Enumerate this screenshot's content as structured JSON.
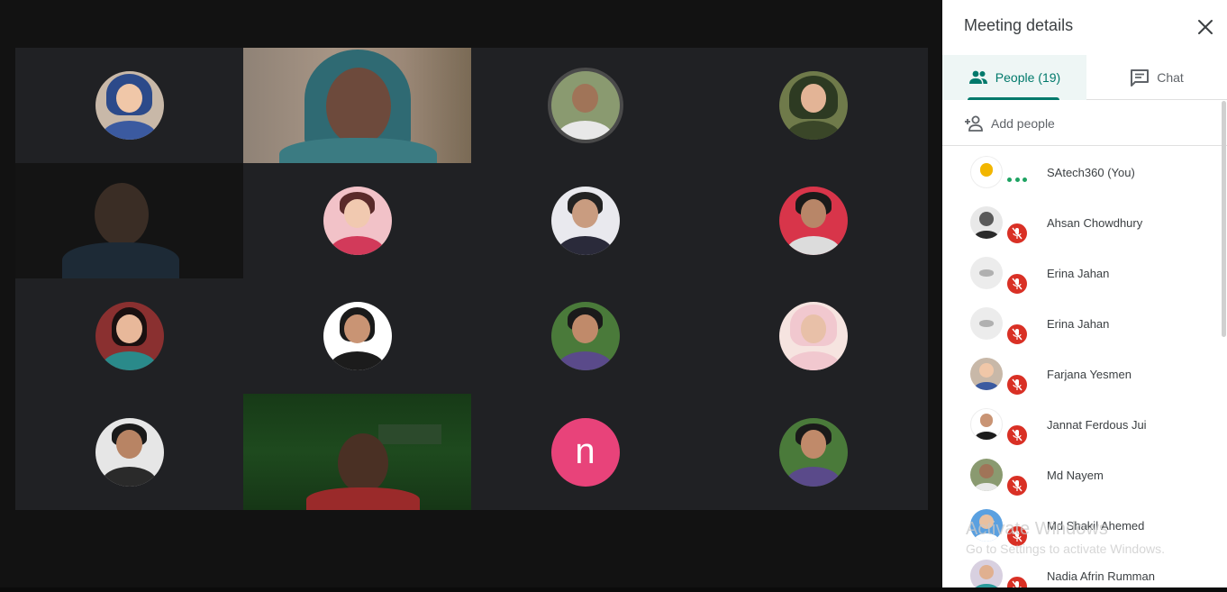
{
  "panel": {
    "title": "Meeting details",
    "tabs": [
      {
        "label": "People (19)",
        "icon": "people-icon",
        "active": true
      },
      {
        "label": "Chat",
        "icon": "chat-icon",
        "active": false
      }
    ],
    "add_people_label": "Add people",
    "participants": [
      {
        "name": "SAtech360 (You)",
        "status": "speaking-dots"
      },
      {
        "name": "Ahsan Chowdhury",
        "status": "muted"
      },
      {
        "name": "Erina Jahan",
        "status": "muted"
      },
      {
        "name": "Erina Jahan",
        "status": "muted"
      },
      {
        "name": "Farjana Yesmen",
        "status": "muted"
      },
      {
        "name": "Jannat Ferdous Jui",
        "status": "muted"
      },
      {
        "name": "Md Nayem",
        "status": "muted"
      },
      {
        "name": "Md Shakil Ahemed",
        "status": "muted"
      },
      {
        "name": "Nadia Afrin Rumman",
        "status": "muted"
      }
    ]
  },
  "grid": {
    "letter_avatar": "n",
    "letter_avatar_color": "#e8437a"
  },
  "watermark": {
    "title": "Activate Windows",
    "subtitle": "Go to Settings to activate Windows."
  },
  "colors": {
    "accent": "#00796b",
    "muted_red": "#d93025",
    "tile_bg": "#202124"
  }
}
